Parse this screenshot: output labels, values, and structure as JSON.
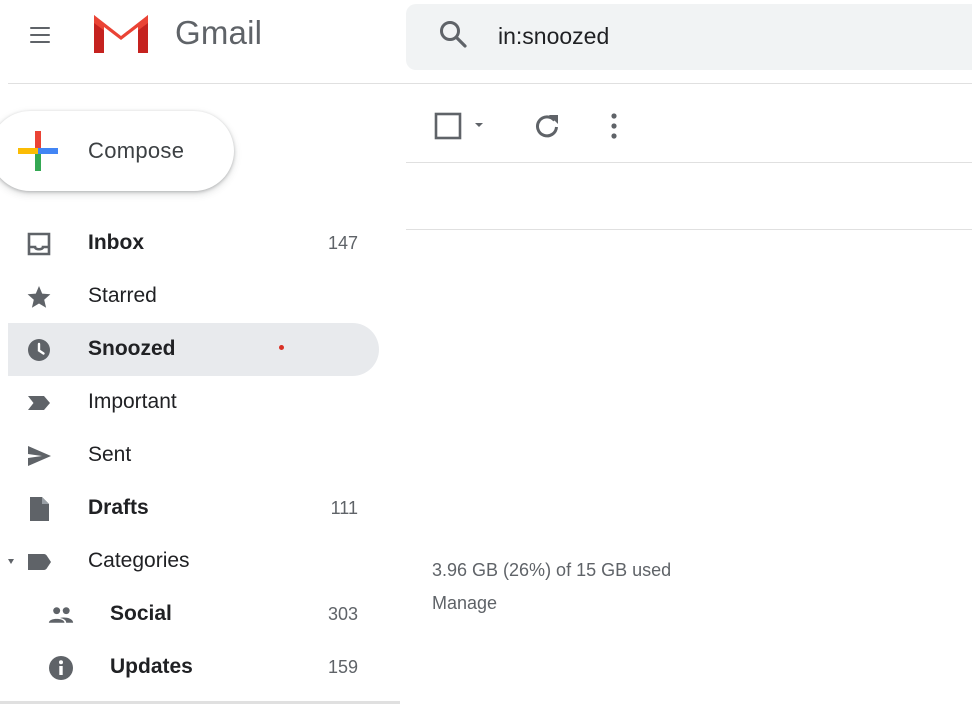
{
  "app": {
    "name": "Gmail"
  },
  "search": {
    "value": "in:snoozed"
  },
  "compose": {
    "label": "Compose"
  },
  "sidebar": {
    "items": [
      {
        "label": "Inbox",
        "count": "147",
        "icon": "inbox-icon"
      },
      {
        "label": "Starred",
        "count": "",
        "icon": "star-icon"
      },
      {
        "label": "Snoozed",
        "count": "",
        "icon": "clock-icon"
      },
      {
        "label": "Important",
        "count": "",
        "icon": "important-icon"
      },
      {
        "label": "Sent",
        "count": "",
        "icon": "send-icon"
      },
      {
        "label": "Drafts",
        "count": "111",
        "icon": "draft-icon"
      },
      {
        "label": "Categories",
        "count": "",
        "icon": "label-icon"
      },
      {
        "label": "Social",
        "count": "303",
        "icon": "people-icon"
      },
      {
        "label": "Updates",
        "count": "159",
        "icon": "info-icon"
      }
    ]
  },
  "footer": {
    "storage": "3.96 GB (26%) of 15 GB used",
    "manage": "Manage"
  },
  "colors": {
    "active_bg": "#e8eaed",
    "search_bg": "#f1f3f4",
    "gmail_red": "#ea4335",
    "icon_gray": "#5f6368",
    "snooze_dot": "#d93025"
  }
}
